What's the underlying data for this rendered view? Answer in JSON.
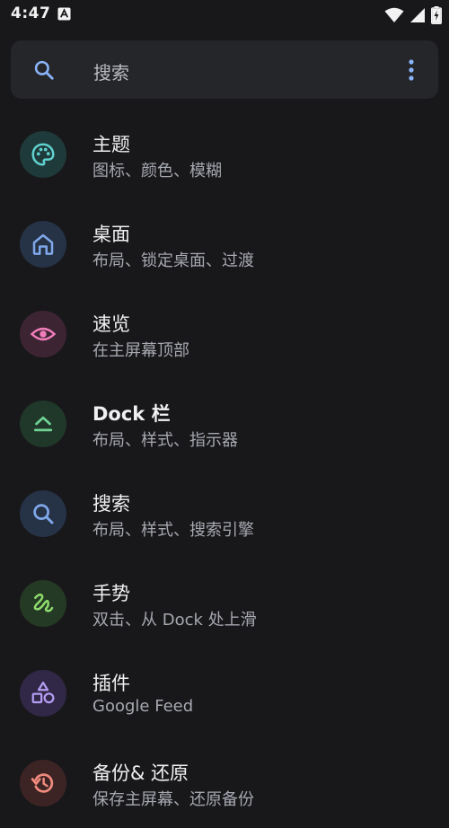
{
  "status_bar": {
    "time": "4:47",
    "icons": [
      "app-a-icon",
      "wifi-icon",
      "signal-icon",
      "battery-charging-icon"
    ]
  },
  "search": {
    "placeholder": "搜索",
    "icon": "search-icon",
    "menu_icon": "more-vert-icon"
  },
  "items": [
    {
      "title": "主题",
      "subtitle": "图标、颜色、模糊",
      "icon": "palette-icon",
      "bg": "#1f3a3a",
      "fg": "#5fd1cf"
    },
    {
      "title": "桌面",
      "subtitle": "布局、锁定桌面、过渡",
      "icon": "home-icon",
      "bg": "#263246",
      "fg": "#7fa8ea"
    },
    {
      "title": "速览",
      "subtitle": "在主屏幕顶部",
      "icon": "eye-icon",
      "bg": "#3d2433",
      "fg": "#f07dba"
    },
    {
      "title": "Dock 栏",
      "subtitle": "布局、样式、指示器",
      "icon": "dock-icon",
      "bg": "#203829",
      "fg": "#6fd394"
    },
    {
      "title": "搜索",
      "subtitle": "布局、样式、搜索引擎",
      "icon": "search-icon",
      "bg": "#263246",
      "fg": "#7fa8ea"
    },
    {
      "title": "手势",
      "subtitle": "双击、从 Dock 处上滑",
      "icon": "gesture-icon",
      "bg": "#253a24",
      "fg": "#8fdc6e"
    },
    {
      "title": "插件",
      "subtitle": "Google Feed",
      "icon": "shapes-icon",
      "bg": "#302846",
      "fg": "#b49cf2"
    },
    {
      "title": "备份& 还原",
      "subtitle": "保存主屏幕、还原备份",
      "icon": "restore-icon",
      "bg": "#3d2424",
      "fg": "#f08a7e"
    }
  ]
}
